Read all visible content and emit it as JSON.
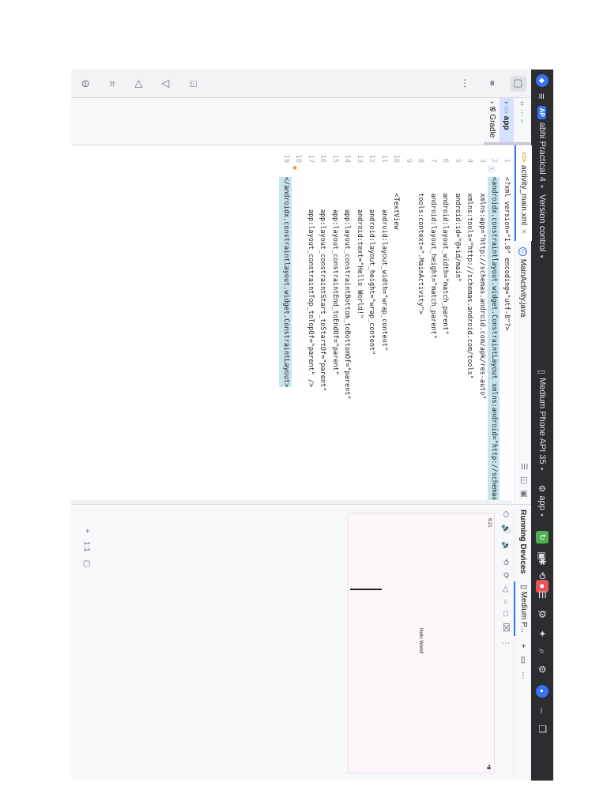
{
  "titlebar": {
    "project_badge": "AP",
    "project_name": "abhi Practical 4",
    "vcs": "Version control",
    "device": "Medium Phone API 35",
    "run_config": "app"
  },
  "project_panel": {
    "root": "app",
    "gradle": "Gradle"
  },
  "editor": {
    "tabs": [
      {
        "label": "activity_main.xml"
      },
      {
        "label": "MainActivity.java"
      }
    ],
    "lines": [
      {
        "n": "1",
        "text": "<?xml version=\"1.0\" encoding=\"utf-8\"?>"
      },
      {
        "n": "2",
        "text": "<androidx.constraintlayout.widget.ConstraintLayout xmlns:android=\"http://schemas.android.com/apk/res/android\""
      },
      {
        "n": "3",
        "text": "    xmlns:app=\"http://schemas.android.com/apk/res-auto\""
      },
      {
        "n": "4",
        "text": "    xmlns:tools=\"http://schemas.android.com/tools\""
      },
      {
        "n": "5",
        "text": "    android:id=\"@+id/main\""
      },
      {
        "n": "6",
        "text": "    android:layout_width=\"match_parent\""
      },
      {
        "n": "7",
        "text": "    android:layout_height=\"match_parent\""
      },
      {
        "n": "8",
        "text": "    tools:context=\".MainActivity\">"
      },
      {
        "n": "9",
        "text": ""
      },
      {
        "n": "10",
        "text": "    <TextView"
      },
      {
        "n": "11",
        "text": "        android:layout_width=\"wrap_content\""
      },
      {
        "n": "12",
        "text": "        android:layout_height=\"wrap_content\""
      },
      {
        "n": "13",
        "text": "        android:text=\"Hello World!\""
      },
      {
        "n": "14",
        "text": "        app:layout_constraintBottom_toBottomOf=\"parent\""
      },
      {
        "n": "15",
        "text": "        app:layout_constraintEnd_toEndOf=\"parent\""
      },
      {
        "n": "16",
        "text": "        app:layout_constraintStart_toStartOf=\"parent\""
      },
      {
        "n": "17",
        "text": "        app:layout_constraintTop_toTopOf=\"parent\" />"
      },
      {
        "n": "18",
        "text": ""
      },
      {
        "n": "19",
        "text": "</androidx.constraintlayout.widget.ConstraintLayout>"
      }
    ]
  },
  "devices": {
    "title": "Running Devices",
    "tab_label": "Medium P...",
    "clock": "6:21",
    "hello_text": "Hello World!"
  },
  "colors": {
    "accent": "#3574f0",
    "run": "#4caf50",
    "stop": "#e55757",
    "highlight": "#c5e4ec"
  }
}
